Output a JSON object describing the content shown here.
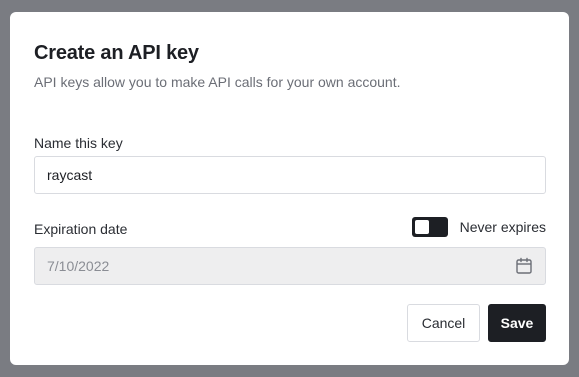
{
  "modal": {
    "title": "Create an API key",
    "subtitle": "API keys allow you to make API calls for your own account."
  },
  "name_field": {
    "label": "Name this key",
    "value": "raycast"
  },
  "expiration": {
    "label": "Expiration date",
    "toggle_label": "Never expires",
    "toggle_on": true,
    "date_value": "7/10/2022",
    "icon": "calendar-icon"
  },
  "actions": {
    "cancel_label": "Cancel",
    "save_label": "Save"
  },
  "colors": {
    "primary": "#1d1f24",
    "backdrop": "#7a7c82",
    "disabled_input": "#eeeeef"
  }
}
